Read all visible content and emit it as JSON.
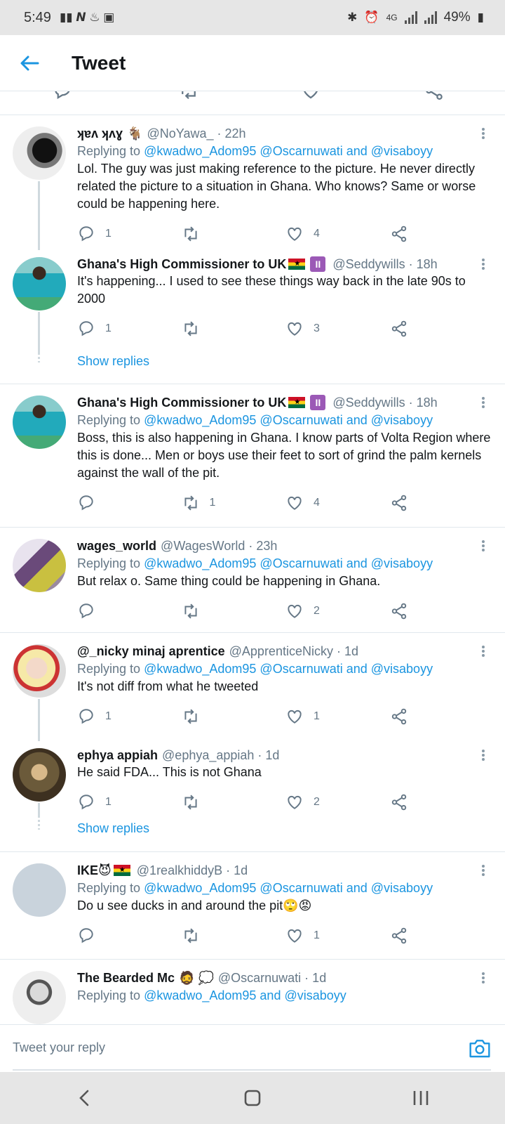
{
  "status": {
    "time": "5:49",
    "network": "4G",
    "battery": "49%"
  },
  "header": {
    "title": "Tweet"
  },
  "tweets": [
    {
      "name": "ʞɐʌ ʞʌɣ",
      "badges": "🐐",
      "handle": "@NoYawa_ · 22h",
      "reply_prefix": "Replying to ",
      "reply_to": "@kwadwo_Adom95 @Oscarnuwati and @visaboyy",
      "text": "Lol. The guy was just making reference to the picture. He never directly related the picture to a situation in Ghana. Who knows? Same or worse could be happening here.",
      "replies": "1",
      "retweets": "",
      "likes": "4"
    },
    {
      "name": "Ghana's High Commissioner to UK",
      "badge": "II",
      "handle": "@Seddywills · 18h",
      "text": "It's happening... I used to see these things way back in the late 90s to 2000",
      "replies": "1",
      "retweets": "",
      "likes": "3"
    },
    {
      "name": "Ghana's High Commissioner to UK",
      "badge": "II",
      "handle": "@Seddywills · 18h",
      "reply_prefix": "Replying to ",
      "reply_to": "@kwadwo_Adom95 @Oscarnuwati and @visaboyy",
      "text": "Boss, this is also happening in Ghana. I know parts of Volta Region where this is done... Men or boys use their feet to sort of grind the palm kernels against the wall of the pit.",
      "replies": "",
      "retweets": "1",
      "likes": "4"
    },
    {
      "name": "wages_world",
      "handle": "@WagesWorld · 23h",
      "reply_prefix": "Replying to ",
      "reply_to": "@kwadwo_Adom95 @Oscarnuwati and @visaboyy",
      "text": "But relax o. Same thing could be happening in Ghana.",
      "replies": "",
      "retweets": "",
      "likes": "2"
    },
    {
      "name": "@_nicky minaj aprentice",
      "handle": "@ApprenticeNicky · 1d",
      "reply_prefix": "Replying to ",
      "reply_to": "@kwadwo_Adom95 @Oscarnuwati and @visaboyy",
      "text": "It's not diff from what he tweeted",
      "replies": "1",
      "retweets": "",
      "likes": "1"
    },
    {
      "name": "ephya appiah",
      "handle": "@ephya_appiah · 1d",
      "text": "He said FDA... This is not Ghana",
      "replies": "1",
      "retweets": "",
      "likes": "2"
    },
    {
      "name": "IKE😈",
      "handle": "@1realkhiddyB · 1d",
      "reply_prefix": "Replying to ",
      "reply_to": "@kwadwo_Adom95 @Oscarnuwati and @visaboyy",
      "text": "Do u see ducks in and around the pit🙄😡",
      "replies": "",
      "retweets": "",
      "likes": "1"
    },
    {
      "name": "The Bearded Mc",
      "badges": "🧔 💭",
      "handle": "@Oscarnuwati · 1d",
      "reply_prefix": "Replying to ",
      "reply_to": "@kwadwo_Adom95 and @visaboyy"
    }
  ],
  "show_replies": "Show replies",
  "compose": {
    "placeholder": "Tweet your reply"
  },
  "icons": {
    "back": "back-arrow-icon",
    "camera": "camera-icon"
  },
  "colors": {
    "accent": "#1b95e0",
    "muted": "#657786"
  }
}
